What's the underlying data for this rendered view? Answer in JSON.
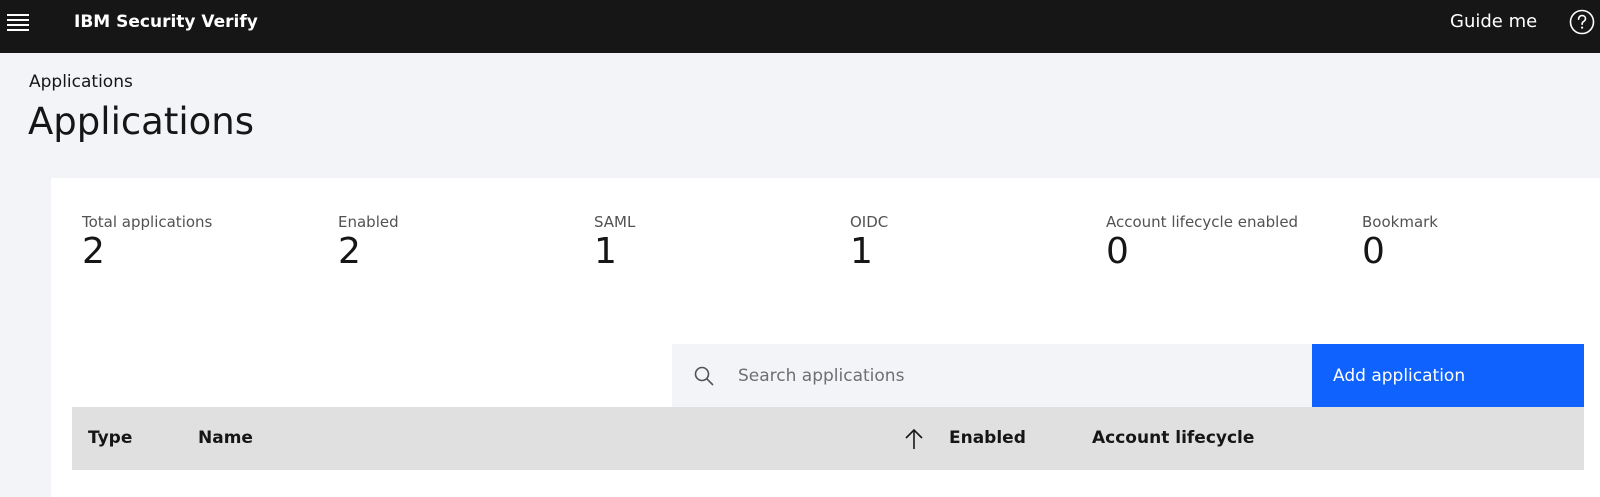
{
  "header": {
    "brand": "IBM Security Verify",
    "guide_me": "Guide me",
    "icons": {
      "menu": "hamburger-menu-icon",
      "help": "help-circle-icon"
    }
  },
  "breadcrumb": "Applications",
  "page_title": "Applications",
  "stats": [
    {
      "label": "Total applications",
      "value": "2"
    },
    {
      "label": "Enabled",
      "value": "2"
    },
    {
      "label": "SAML",
      "value": "1"
    },
    {
      "label": "OIDC",
      "value": "1"
    },
    {
      "label": "Account lifecycle enabled",
      "value": "0"
    },
    {
      "label": "Bookmark",
      "value": "0"
    }
  ],
  "search": {
    "placeholder": "Search applications",
    "value": ""
  },
  "toolbar": {
    "add_label": "Add application"
  },
  "table": {
    "columns": [
      "Type",
      "Name",
      "Enabled",
      "Account lifecycle"
    ],
    "sort": {
      "column": "Name",
      "direction": "ascending"
    },
    "rows": []
  },
  "colors": {
    "header_bg": "#161616",
    "page_bg": "#f2f4f8",
    "primary_button": "#0f62fe",
    "table_header_bg": "#e0e0e0"
  }
}
